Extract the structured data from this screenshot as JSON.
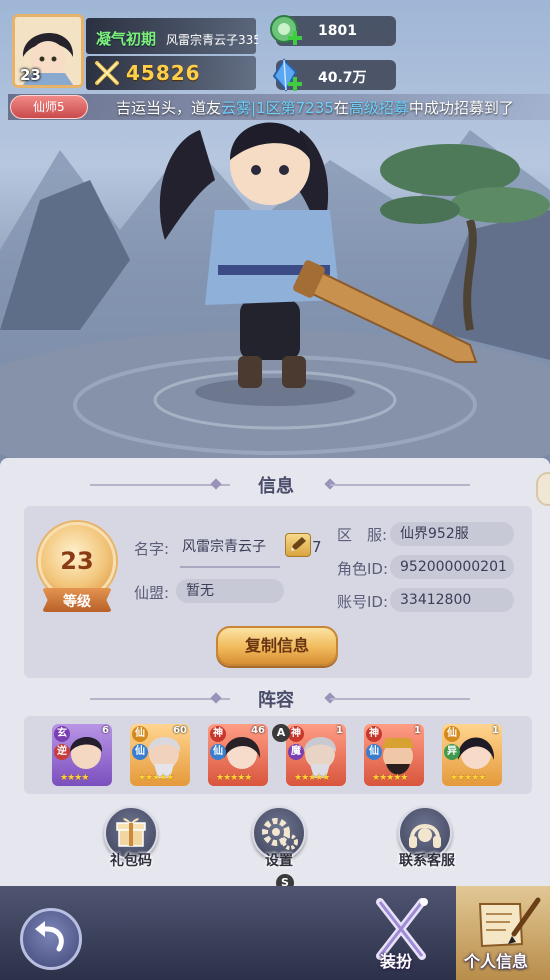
{
  "header": {
    "avatar_level": "23",
    "realm": "凝气初期",
    "player_name": "风雷宗青云子335",
    "power": "45826",
    "resource_1": "1801",
    "resource_2": "40.7万"
  },
  "ticker": {
    "badge": "仙师5",
    "prefix": "吉运当头，道友",
    "player": "云雾|1区第7235",
    "middle": "在",
    "event": "高级招募",
    "suffix": "中成功招募到了"
  },
  "info": {
    "title": "信息",
    "level": "23",
    "level_label": "等级",
    "name_label": "名字:",
    "name_value": "风雷宗青云子",
    "name_suffix": "7",
    "guild_label": "仙盟:",
    "guild_value": "暂无",
    "server_label": "区　服:",
    "server_value": "仙界952服",
    "role_label": "角色ID:",
    "role_value": "952000000201",
    "account_label": "账号ID:",
    "account_value": "33412800",
    "copy_button": "复制信息"
  },
  "lineup": {
    "title": "阵容",
    "heroes": [
      {
        "top_badge": "玄",
        "side_badge": "逆",
        "level": "6",
        "stars": "★★★★"
      },
      {
        "top_badge": "仙",
        "side_badge": "仙",
        "level": "60",
        "stars": "★★★★★"
      },
      {
        "top_badge": "神",
        "side_badge": "仙",
        "level": "46",
        "stars": "★★★★★"
      },
      {
        "top_badge": "神",
        "side_badge": "魔",
        "level": "1",
        "stars": "★★★★★"
      },
      {
        "top_badge": "神",
        "side_badge": "仙",
        "level": "1",
        "stars": "★★★★★"
      },
      {
        "top_badge": "仙",
        "side_badge": "异",
        "level": "1",
        "stars": "★★★★★"
      }
    ],
    "marker_a": "A",
    "marker_s": "S"
  },
  "actions": {
    "gift_code": "礼包码",
    "settings": "设置",
    "support": "联系客服"
  },
  "bottom": {
    "dress_tab": "装扮",
    "profile_tab": "个人信息"
  }
}
